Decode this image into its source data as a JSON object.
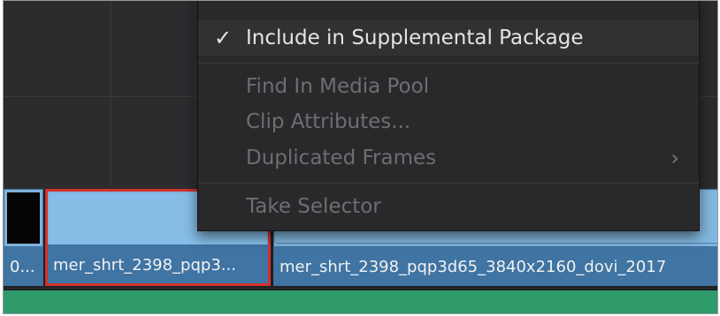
{
  "timeline": {
    "clips": [
      {
        "label": "0..."
      },
      {
        "label": "mer_shrt_2398_pqp3..."
      },
      {
        "label": "mer_shrt_2398_pqp3d65_3840x2160_dovi_2017"
      }
    ]
  },
  "context_menu": {
    "items": [
      {
        "label": "Include in Supplemental Package",
        "checked": true,
        "enabled": true,
        "check_glyph": "✓"
      },
      {
        "label": "Find In Media Pool",
        "enabled": false
      },
      {
        "label": "Clip Attributes...",
        "enabled": false
      },
      {
        "label": "Duplicated Frames",
        "enabled": false,
        "submenu_glyph": "›"
      },
      {
        "label": "Take Selector",
        "enabled": false
      }
    ]
  },
  "colors": {
    "selection_border": "#d3312c",
    "clip_blue": "#3f74a3",
    "audio_green": "#2f9b6a"
  }
}
